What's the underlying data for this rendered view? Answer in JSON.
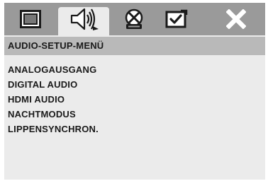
{
  "tabs": [
    {
      "icon": "monitor-icon",
      "selected": false
    },
    {
      "icon": "speaker-icon",
      "selected": true
    },
    {
      "icon": "dolby-icon",
      "selected": false
    },
    {
      "icon": "preference-check-icon",
      "selected": false
    },
    {
      "icon": "close-icon",
      "selected": false
    }
  ],
  "menu": {
    "title": "AUDIO-SETUP-MENÜ",
    "items": [
      "ANALOGAUSGANG",
      "DIGITAL AUDIO",
      "HDMI AUDIO",
      "NACHTMODUS",
      "LIPPENSYNCHRON."
    ]
  },
  "colors": {
    "tab_bar": "#9a9a9a",
    "menu_title_bar": "#b9b9b9",
    "panel": "#ebebeb",
    "text": "#1a1a1a",
    "icon": "#1a1a1a",
    "close_icon": "#ffffff"
  }
}
